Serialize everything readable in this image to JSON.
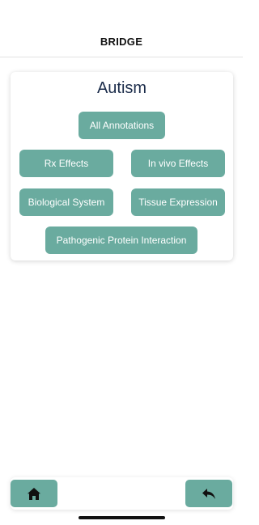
{
  "header": {
    "title": "BRIDGE"
  },
  "card": {
    "title": "Autism",
    "buttons": {
      "all_annotations": "All Annotations",
      "rx_effects": "Rx Effects",
      "in_vivo_effects": "In vivo Effects",
      "biological_system": "Biological System",
      "tissue_expression": "Tissue Expression",
      "pathogenic_protein_interaction": "Pathogenic Protein Interaction"
    }
  },
  "footer": {
    "home_icon": "home-icon",
    "back_icon": "back-arrow-icon"
  },
  "colors": {
    "accent": "#6aab9f",
    "title_text": "#1b2c4a",
    "button_text": "#ffffff"
  }
}
